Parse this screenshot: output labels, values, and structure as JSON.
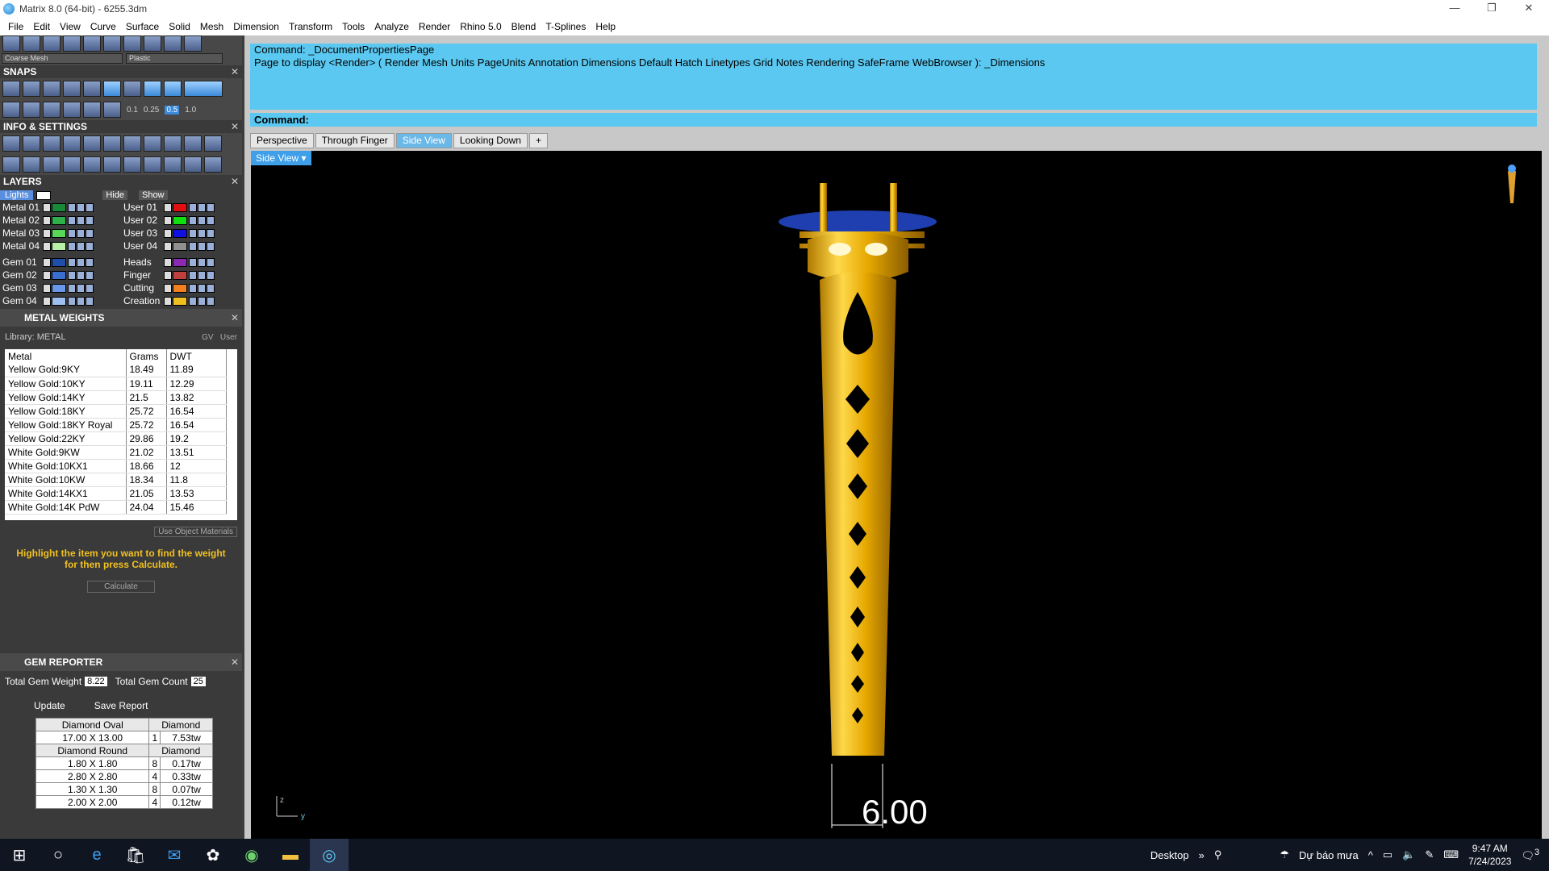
{
  "window": {
    "title": "Matrix 8.0 (64-bit) - 6255.3dm",
    "minimize": "—",
    "maximize": "❐",
    "close": "✕"
  },
  "menu": [
    "File",
    "Edit",
    "View",
    "Curve",
    "Surface",
    "Solid",
    "Mesh",
    "Dimension",
    "Transform",
    "Tools",
    "Analyze",
    "Render",
    "Rhino 5.0",
    "Blend",
    "T-Splines",
    "Help"
  ],
  "mesh_combo": "Coarse Mesh",
  "material_combo": "Plastic",
  "snaps": {
    "title": "SNAPS",
    "values": [
      "0.1",
      "0.25",
      "0.5",
      "1.0"
    ]
  },
  "info": {
    "title": "INFO & SETTINGS"
  },
  "layers": {
    "title": "LAYERS",
    "lights_label": "Lights",
    "hide_label": "Hide",
    "show_label": "Show",
    "left": [
      {
        "name": "Metal 01",
        "color": "#1a8a3a"
      },
      {
        "name": "Metal 02",
        "color": "#2fb04a"
      },
      {
        "name": "Metal 03",
        "color": "#58d858"
      },
      {
        "name": "Metal 04",
        "color": "#b8f0a8"
      },
      {
        "name": "Gem 01",
        "color": "#1f4fa8"
      },
      {
        "name": "Gem 02",
        "color": "#3a6fd0"
      },
      {
        "name": "Gem 03",
        "color": "#6a98e8"
      },
      {
        "name": "Gem 04",
        "color": "#9ec0f0"
      }
    ],
    "right": [
      {
        "name": "User 01",
        "color": "#e01010"
      },
      {
        "name": "User 02",
        "color": "#10e010"
      },
      {
        "name": "User 03",
        "color": "#1010e0"
      },
      {
        "name": "User 04",
        "color": "#909090"
      },
      {
        "name": "Heads",
        "color": "#8a2ab0"
      },
      {
        "name": "Finger",
        "color": "#c04040"
      },
      {
        "name": "Cutting",
        "color": "#f08020"
      },
      {
        "name": "Creation",
        "color": "#f0c020"
      }
    ]
  },
  "metal_weights": {
    "title": "METAL WEIGHTS",
    "library": "Library: METAL",
    "gv_label": "GV",
    "user_label": "User",
    "columns": [
      "Metal",
      "Grams",
      "DWT"
    ],
    "rows": [
      [
        "Yellow Gold:9KY",
        "18.49",
        "11.89"
      ],
      [
        "Yellow Gold:10KY",
        "19.11",
        "12.29"
      ],
      [
        "Yellow Gold:14KY",
        "21.5",
        "13.82"
      ],
      [
        "Yellow Gold:18KY",
        "25.72",
        "16.54"
      ],
      [
        "Yellow Gold:18KY Royal",
        "25.72",
        "16.54"
      ],
      [
        "Yellow Gold:22KY",
        "29.86",
        "19.2"
      ],
      [
        "White Gold:9KW",
        "21.02",
        "13.51"
      ],
      [
        "White Gold:10KX1",
        "18.66",
        "12"
      ],
      [
        "White Gold:10KW",
        "18.34",
        "11.8"
      ],
      [
        "White Gold:14KX1",
        "21.05",
        "13.53"
      ],
      [
        "White Gold:14K PdW",
        "24.04",
        "15.46"
      ]
    ],
    "use_object_materials": "Use Object Materials",
    "hint": "Highlight the item you want to find the weight for then press Calculate.",
    "calculate": "Calculate"
  },
  "gem_reporter": {
    "title": "GEM REPORTER",
    "total_weight_label": "Total Gem Weight",
    "total_weight": "8.22",
    "total_count_label": "Total Gem Count",
    "total_count": "25",
    "update": "Update",
    "save_report": "Save Report",
    "groups": [
      {
        "shape": "Diamond Oval",
        "material": "Diamond",
        "rows": [
          [
            "17.00 X 13.00",
            "1",
            "7.53tw"
          ]
        ]
      },
      {
        "shape": "Diamond Round",
        "material": "Diamond",
        "rows": [
          [
            "1.80 X 1.80",
            "8",
            "0.17tw"
          ],
          [
            "2.80 X 2.80",
            "4",
            "0.33tw"
          ],
          [
            "1.30 X 1.30",
            "8",
            "0.07tw"
          ],
          [
            "2.00 X 2.00",
            "4",
            "0.12tw"
          ]
        ]
      }
    ]
  },
  "command": {
    "line1": "Command: _DocumentPropertiesPage",
    "line2": "Page to display <Render> ( Render  Mesh  Units  PageUnits  Annotation  Dimensions  Default  Hatch  Linetypes  Grid  Notes  Rendering  SafeFrame  WebBrowser ): _Dimensions",
    "prompt": "Command:"
  },
  "tabs": [
    "Perspective",
    "Through Finger",
    "Side View",
    "Looking Down",
    "+"
  ],
  "active_tab": "Side View",
  "viewport_label": "Side View",
  "dimension": "6.00",
  "axis": {
    "z": "z",
    "y": "y"
  },
  "taskbar": {
    "desktop": "Desktop",
    "weather": "Dự báo mưa",
    "time": "9:47 AM",
    "date": "7/24/2023",
    "notifications": "3"
  }
}
